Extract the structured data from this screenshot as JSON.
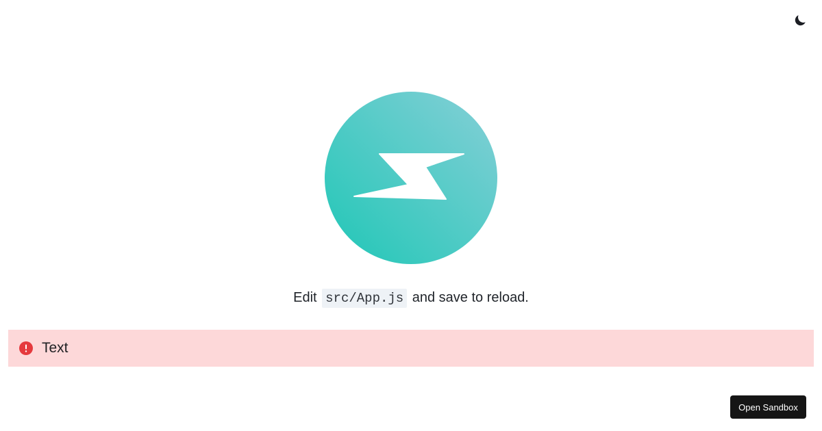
{
  "header": {
    "theme_toggle_icon": "moon-icon"
  },
  "logo": {
    "icon": "lightning-bolt-icon",
    "gradient_start": "#2ec6b9",
    "gradient_end": "#7ecfd4",
    "bolt_color": "#ffffff"
  },
  "instruction": {
    "prefix": "Edit",
    "code": "src/App.js",
    "suffix": "and save to reload."
  },
  "alert": {
    "icon": "exclamation-circle-icon",
    "icon_color": "#e5393d",
    "background": "#fdd8d9",
    "text": "Text"
  },
  "footer": {
    "open_sandbox_label": "Open Sandbox"
  }
}
